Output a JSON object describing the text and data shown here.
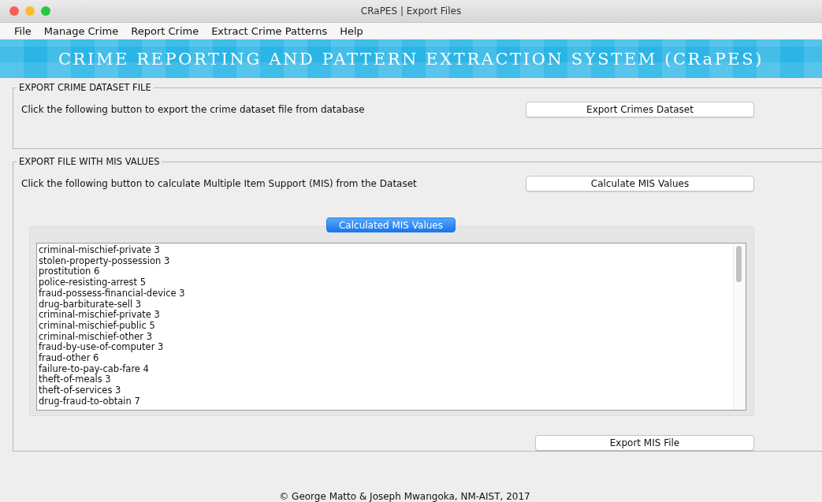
{
  "window": {
    "title": "CRaPES | Export Files"
  },
  "menu": [
    {
      "label": "File"
    },
    {
      "label": "Manage Crime"
    },
    {
      "label": "Report Crime"
    },
    {
      "label": "Extract Crime Patterns"
    },
    {
      "label": "Help"
    }
  ],
  "banner": {
    "title": "CRIME REPORTING AND PATTERN EXTRACTION SYSTEM (CRaPES)"
  },
  "sections": [
    {
      "title": "EXPORT CRIME DATASET FILE",
      "instruction": "Click the following button to export the crime dataset file from database",
      "button": "Export Crimes Dataset"
    },
    {
      "title": "EXPORT FILE WITH MIS VALUES",
      "instruction": "Click the following button to calculate  Multiple Item Support (MIS) from the Dataset",
      "button": "Calculate MIS Values",
      "results": {
        "tab": {
          "label": "Calculated MIS Values",
          "selected": true
        },
        "lines": [
          "criminal-mischief-private 3",
          "stolen-property-possession 3",
          "prostitution 6",
          "police-resisting-arrest 5",
          "fraud-possess-financial-device 3",
          "drug-barbiturate-sell 3",
          "criminal-mischief-private 3",
          "criminal-mischief-public 5",
          "criminal-mischief-other 3",
          "fraud-by-use-of-computer 3",
          "fraud-other 6",
          "failure-to-pay-cab-fare 4",
          "theft-of-meals 3",
          "theft-of-services 3",
          "drug-fraud-to-obtain 7"
        ]
      },
      "export_button": "Export MIS File"
    }
  ],
  "footer": "© George Matto & Joseph Mwangoka, NM-AIST, 2017"
}
